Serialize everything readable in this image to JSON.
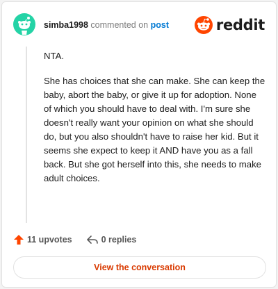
{
  "header": {
    "username": "simba1998",
    "commented_on_text": "commented on",
    "post_link": "post",
    "logo_text": "reddit"
  },
  "comment": {
    "paragraphs": [
      "NTA.",
      "She has choices that she can make. She can keep the baby, abort the baby, or give it up for adoption. None of which you should have to deal with. I'm sure she doesn't really want your opinion on what she should do, but you also shouldn't have to raise her kid. But it seems she expect to keep it AND have you as a fall back. But she got herself into this, she needs to make adult choices."
    ]
  },
  "actions": {
    "upvotes": "11 upvotes",
    "replies": "0 replies"
  },
  "view_button": "View the conversation",
  "colors": {
    "accent": "#d93a00",
    "upvote": "#ff4500",
    "link": "#0079d3",
    "avatar_bg": "#24d3a6"
  },
  "icons": [
    "snoo-avatar-icon",
    "reddit-logo-icon",
    "upvote-arrow-icon",
    "reply-icon"
  ]
}
